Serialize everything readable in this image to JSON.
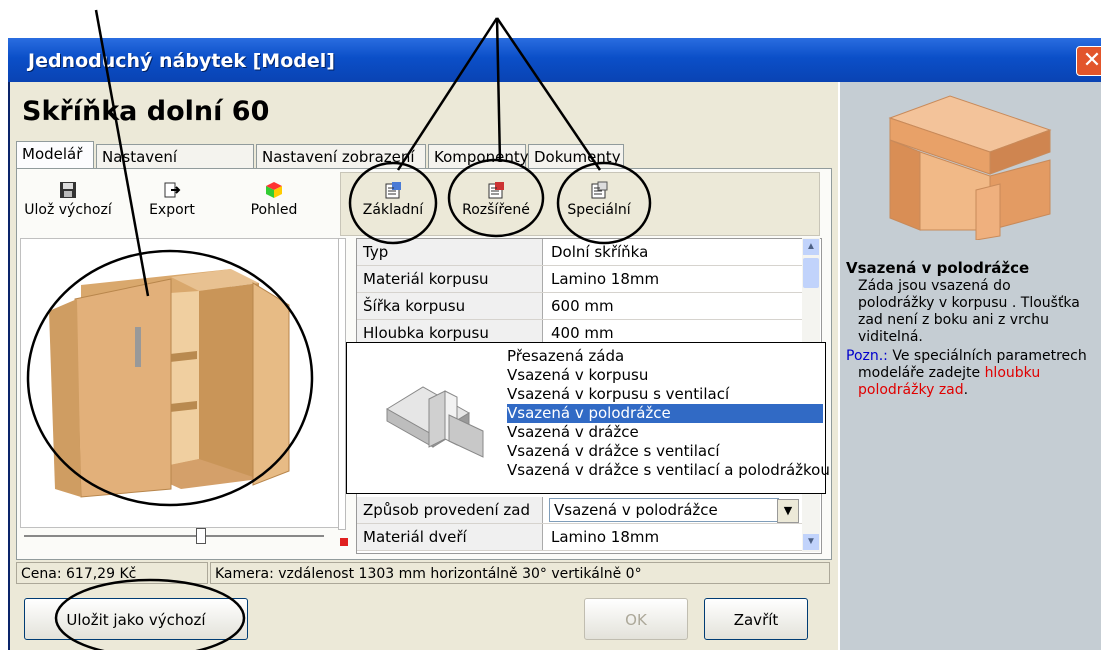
{
  "window": {
    "title": "Jednoduchý nábytek [Model]",
    "close_glyph": "✕"
  },
  "heading": "Skříňka dolní 60",
  "tabs": [
    {
      "label": "Modelář",
      "active": true
    },
    {
      "label": "Nastavení modeláře"
    },
    {
      "label": "Nastavení zobrazení"
    },
    {
      "label": "Komponenty"
    },
    {
      "label": "Dokumenty"
    }
  ],
  "toolbar_left": {
    "save_default": "Ulož výchozí",
    "export": "Export",
    "view": "Pohled"
  },
  "toolbar_right": {
    "basic": "Základní",
    "extended": "Rozšířené",
    "special": "Speciální"
  },
  "properties": [
    {
      "key": "Typ",
      "value": "Dolní skříňka"
    },
    {
      "key": "Materiál korpusu",
      "value": "Lamino 18mm"
    },
    {
      "key": "Šířka korpusu",
      "value": "600 mm"
    },
    {
      "key": "Hloubka korpusu",
      "value": "400 mm"
    },
    {
      "key": "Způsob provedení zad",
      "value": "Vsazená v polodrážce"
    },
    {
      "key": "Materiál dveří",
      "value": "Lamino 18mm"
    }
  ],
  "dropdown": {
    "options": [
      "Přesazená záda",
      "Vsazená v korpusu",
      "Vsazená v korpusu s ventilací",
      "Vsazená v polodrážce",
      "Vsazená v drážce",
      "Vsazená v drážce s ventilací",
      "Vsazená v drážce s ventilací a polodrážkou"
    ],
    "selected_index": 3
  },
  "status": {
    "price": "Cena: 617,29 Kč",
    "camera": "Kamera: vzdálenost 1303 mm   horizontálně 30°   vertikálně 0°"
  },
  "buttons": {
    "save_as_default": "Uložit jako výchozí",
    "ok": "OK",
    "close": "Zavřít"
  },
  "help": {
    "title": "Vsazená v polodrážce",
    "lines": [
      "Záda jsou vsazená do",
      "polodrážky v korpusu . Tloušťka",
      "zad není z boku ani z vrchu",
      "viditelná."
    ],
    "note_label": "Pozn.:",
    "note_line1": " Ve speciálních parametrech",
    "note_line2": "modeláře zadejte ",
    "note_highlight1": "hloubku",
    "note_highlight2": "polodrážky zad",
    "note_end": "."
  },
  "colors": {
    "title_bar": "#0b4fc8",
    "selection": "#316ac5",
    "note_label": "#0000cc",
    "note_highlight": "#e00000",
    "wood": "#e2b07a"
  }
}
